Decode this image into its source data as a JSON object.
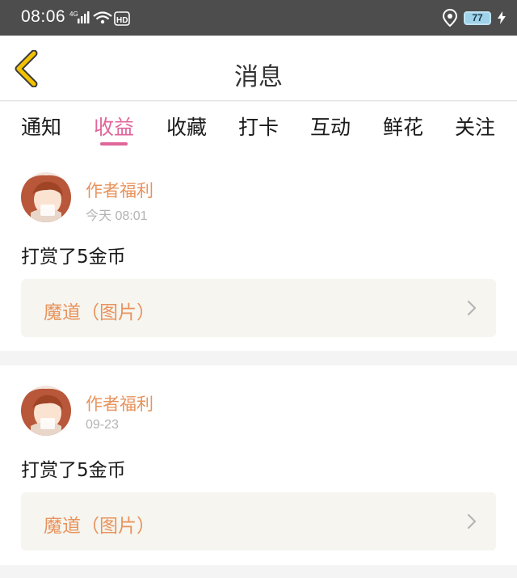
{
  "status": {
    "time": "08:06",
    "network": "4G",
    "hd": "HD",
    "battery": "77"
  },
  "header": {
    "title": "消息"
  },
  "tabs": [
    {
      "label": "通知",
      "active": false
    },
    {
      "label": "收益",
      "active": true
    },
    {
      "label": "收藏",
      "active": false
    },
    {
      "label": "打卡",
      "active": false
    },
    {
      "label": "互动",
      "active": false
    },
    {
      "label": "鲜花",
      "active": false
    },
    {
      "label": "关注",
      "active": false
    }
  ],
  "messages": [
    {
      "author": "作者福利",
      "time": "今天 08:01",
      "text": "打赏了5金币",
      "link": "魔道（图片）"
    },
    {
      "author": "作者福利",
      "time": "09-23",
      "text": "打赏了5金币",
      "link": "魔道（图片）"
    }
  ],
  "colors": {
    "accent": "#e0669a",
    "author": "#e8935d",
    "back_icon": "#f2c200",
    "statusbar": "#4d4d4d"
  }
}
